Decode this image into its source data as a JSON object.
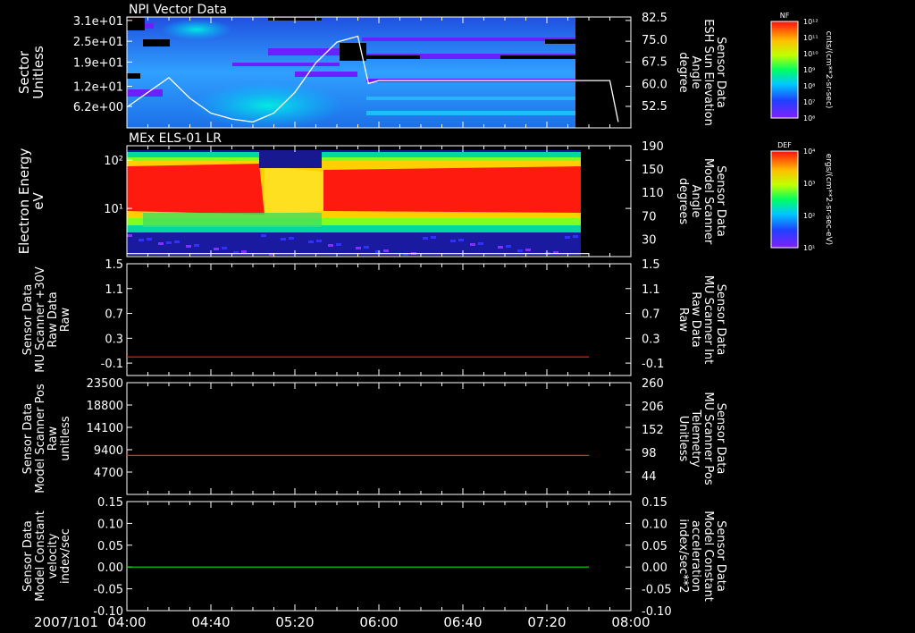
{
  "date_label": "2007/101",
  "time_ticks": [
    "04:00",
    "04:40",
    "05:20",
    "06:00",
    "06:40",
    "07:20",
    "08:00"
  ],
  "colorbars": [
    {
      "title": "NF",
      "unit": "cnts/(cm**2-sr-sec)",
      "tick_labels": [
        "10¹²",
        "10¹¹",
        "10¹⁰",
        "10⁹",
        "10⁸",
        "10⁷",
        "10⁶"
      ]
    },
    {
      "title": "DEF",
      "unit": "ergs/(cm**2-sr-sec-eV)",
      "tick_labels": [
        "10⁴",
        "10³",
        "10²",
        "10¹"
      ]
    }
  ],
  "chart_data": [
    {
      "type": "heatmap",
      "title": "NPI Vector Data",
      "left_label": [
        "Sector",
        "Unitless"
      ],
      "left_ticks": [
        "3.1e+01",
        "2.5e+01",
        "1.9e+01",
        "1.2e+01",
        "6.2e+00"
      ],
      "left_tick_values": [
        31,
        25,
        19,
        12,
        6.2
      ],
      "ylim": [
        0,
        32
      ],
      "right_label": [
        "Sensor Data",
        "ESH Sun Elevation",
        "Angle",
        "degree"
      ],
      "right_ticks": [
        "82.5",
        "75.0",
        "67.5",
        "60.0",
        "52.5"
      ],
      "right_ylim": [
        45,
        82.5
      ],
      "line_color": "#ffffff",
      "overlay_series": {
        "name": "ESH Sun Elevation Angle",
        "x": [
          "04:00",
          "04:10",
          "04:20",
          "04:30",
          "04:40",
          "04:50",
          "05:00",
          "05:10",
          "05:20",
          "05:30",
          "05:40",
          "05:50",
          "05:55",
          "06:00",
          "07:40",
          "07:50",
          "07:54"
        ],
        "y": [
          52,
          57,
          62,
          55,
          50,
          48,
          47,
          50,
          57,
          67,
          74,
          76,
          60,
          61,
          61,
          61,
          47
        ]
      }
    },
    {
      "type": "heatmap",
      "title": "MEx ELS-01 LR",
      "left_label": [
        "Electron Energy",
        "eV"
      ],
      "left_ticks": [
        "10²",
        "10¹"
      ],
      "left_tick_values": [
        100,
        10
      ],
      "log_scale": true,
      "ylim": [
        1,
        200
      ],
      "right_label": [
        "Sensor Data",
        "Model Scanner",
        "Angle",
        "degrees"
      ],
      "right_ticks": [
        "190",
        "150",
        "110",
        "70",
        "30"
      ],
      "right_ylim": [
        0,
        190
      ],
      "line_color": "#ffffff",
      "overlay_series": {
        "name": "Model Scanner Angle",
        "x": [
          "04:00",
          "07:40"
        ],
        "y": [
          5,
          5
        ]
      }
    },
    {
      "type": "line",
      "left_label": [
        "Sensor Data",
        "MU Scanner +30V",
        "Raw Data",
        "Raw"
      ],
      "left_ticks": [
        "1.5",
        "1.1",
        "0.7",
        "0.3",
        "-0.1"
      ],
      "ylim": [
        -0.3,
        1.5
      ],
      "right_label": [
        "Sensor Data",
        "MU Scanner Int",
        "Raw Data",
        "Raw"
      ],
      "right_ticks": [
        "1.5",
        "1.1",
        "0.7",
        "0.3",
        "-0.1"
      ],
      "right_ylim": [
        -0.3,
        1.5
      ],
      "right_label_color": "#ff2020",
      "line_color": "#ff2020",
      "series": [
        {
          "x": [
            "04:00",
            "07:40"
          ],
          "y": [
            0.0,
            0.0
          ]
        }
      ]
    },
    {
      "type": "line",
      "left_label": [
        "Sensor Data",
        "Model Scanner Pos",
        "Raw",
        "unitless"
      ],
      "left_ticks": [
        "23500",
        "18800",
        "14100",
        "9400",
        "4700"
      ],
      "ylim": [
        0,
        23500
      ],
      "right_label": [
        "Sensor Data",
        "MU Scanner Pos",
        "Telemetry",
        "Unitless"
      ],
      "right_ticks": [
        "260",
        "206",
        "152",
        "98",
        "44"
      ],
      "right_ylim": [
        0,
        260
      ],
      "right_label_color": "#ff2020",
      "line_color": "#ff2020",
      "series": [
        {
          "x": [
            "04:00",
            "07:40"
          ],
          "y": [
            8200,
            8200
          ]
        }
      ]
    },
    {
      "type": "line",
      "left_label": [
        "Sensor Data",
        "Model Constant",
        "velocity",
        "index/sec"
      ],
      "left_ticks": [
        "0.15",
        "0.10",
        "0.05",
        "0.00",
        "-0.05",
        "-0.10"
      ],
      "ylim": [
        -0.1,
        0.15
      ],
      "right_label": [
        "Sensor Data",
        "Model Constant",
        "acceleration",
        "index/sec**2"
      ],
      "right_ticks": [
        "0.15",
        "0.10",
        "0.05",
        "0.00",
        "-0.05",
        "-0.10"
      ],
      "right_ylim": [
        -0.1,
        0.15
      ],
      "right_label_color": "#00e000",
      "line_color": "#00e000",
      "series": [
        {
          "x": [
            "04:00",
            "07:40"
          ],
          "y": [
            0.0,
            0.0
          ]
        }
      ]
    }
  ]
}
